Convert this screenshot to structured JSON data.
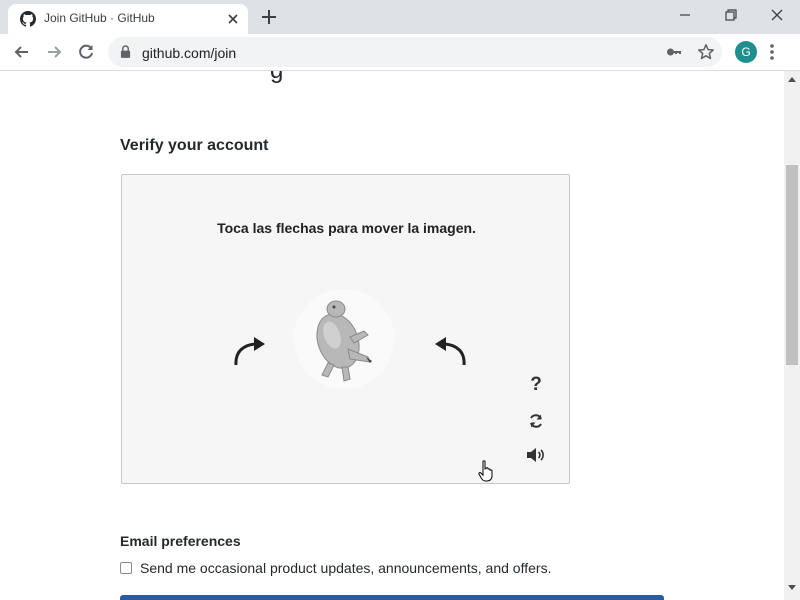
{
  "browser": {
    "tab": {
      "title": "Join GitHub · GitHub",
      "favicon": "github-icon"
    },
    "url": "github.com/join",
    "profile_initial": "G",
    "colors": {
      "tabstrip": "#dee1e6",
      "omnibox": "#f1f3f4",
      "avatar": "#1e8e8e"
    }
  },
  "page": {
    "verify_heading": "Verify your account",
    "captcha": {
      "instruction": "Toca las flechas para mover la imagen.",
      "image": "rotated-animal-figure",
      "controls": {
        "help": "?",
        "reload": "reload-icon",
        "audio": "audio-icon"
      }
    },
    "email_preferences": {
      "heading": "Email preferences",
      "checkbox_label": "Send me occasional product updates, announcements, and offers.",
      "checked": false
    },
    "colors": {
      "submit_button": "#2b5d9e"
    }
  }
}
